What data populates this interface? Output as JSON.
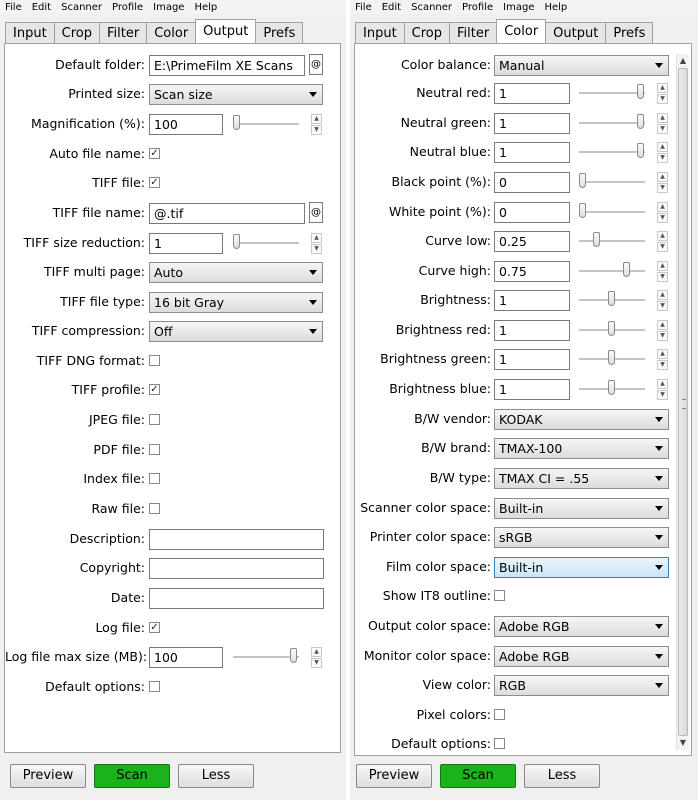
{
  "left": {
    "menu": [
      "File",
      "Edit",
      "Scanner",
      "Profile",
      "Image",
      "Help"
    ],
    "tabs": [
      "Input",
      "Crop",
      "Filter",
      "Color",
      "Output",
      "Prefs"
    ],
    "fields": {
      "default_folder": {
        "label": "Default folder:",
        "value": "E:\\PrimeFilm XE Scans",
        "at": "@"
      },
      "printed_size": {
        "label": "Printed size:",
        "value": "Scan size"
      },
      "magnification": {
        "label": "Magnification (%):",
        "value": "100"
      },
      "auto_file_name": {
        "label": "Auto file name:",
        "checked": true
      },
      "tiff_file": {
        "label": "TIFF file:",
        "checked": true
      },
      "tiff_file_name": {
        "label": "TIFF file name:",
        "value": "@.tif",
        "at": "@"
      },
      "tiff_size_reduction": {
        "label": "TIFF size reduction:",
        "value": "1"
      },
      "tiff_multi_page": {
        "label": "TIFF multi page:",
        "value": "Auto"
      },
      "tiff_file_type": {
        "label": "TIFF file type:",
        "value": "16 bit Gray"
      },
      "tiff_compression": {
        "label": "TIFF compression:",
        "value": "Off"
      },
      "tiff_dng_format": {
        "label": "TIFF DNG format:",
        "checked": false
      },
      "tiff_profile": {
        "label": "TIFF profile:",
        "checked": true
      },
      "jpeg_file": {
        "label": "JPEG file:",
        "checked": false
      },
      "pdf_file": {
        "label": "PDF file:",
        "checked": false
      },
      "index_file": {
        "label": "Index file:",
        "checked": false
      },
      "raw_file": {
        "label": "Raw file:",
        "checked": false
      },
      "description": {
        "label": "Description:",
        "value": ""
      },
      "copyright": {
        "label": "Copyright:",
        "value": ""
      },
      "date": {
        "label": "Date:",
        "value": ""
      },
      "log_file": {
        "label": "Log file:",
        "checked": true
      },
      "log_file_max_size": {
        "label": "Log file max size (MB):",
        "value": "100"
      },
      "default_options": {
        "label": "Default options:",
        "checked": false
      }
    },
    "buttons": {
      "preview": "Preview",
      "scan": "Scan",
      "less": "Less"
    }
  },
  "right": {
    "menu": [
      "File",
      "Edit",
      "Scanner",
      "Profile",
      "Image",
      "Help"
    ],
    "tabs": [
      "Input",
      "Crop",
      "Filter",
      "Color",
      "Output",
      "Prefs"
    ],
    "fields": {
      "color_balance": {
        "label": "Color balance:",
        "value": "Manual"
      },
      "neutral_red": {
        "label": "Neutral red:",
        "value": "1"
      },
      "neutral_green": {
        "label": "Neutral green:",
        "value": "1"
      },
      "neutral_blue": {
        "label": "Neutral blue:",
        "value": "1"
      },
      "black_point": {
        "label": "Black point (%):",
        "value": "0"
      },
      "white_point": {
        "label": "White point (%):",
        "value": "0"
      },
      "curve_low": {
        "label": "Curve low:",
        "value": "0.25"
      },
      "curve_high": {
        "label": "Curve high:",
        "value": "0.75"
      },
      "brightness": {
        "label": "Brightness:",
        "value": "1"
      },
      "brightness_red": {
        "label": "Brightness red:",
        "value": "1"
      },
      "brightness_green": {
        "label": "Brightness green:",
        "value": "1"
      },
      "brightness_blue": {
        "label": "Brightness blue:",
        "value": "1"
      },
      "bw_vendor": {
        "label": "B/W vendor:",
        "value": "KODAK"
      },
      "bw_brand": {
        "label": "B/W brand:",
        "value": "TMAX-100"
      },
      "bw_type": {
        "label": "B/W type:",
        "value": "TMAX CI = .55"
      },
      "scanner_color_space": {
        "label": "Scanner color space:",
        "value": "Built-in"
      },
      "printer_color_space": {
        "label": "Printer color space:",
        "value": "sRGB"
      },
      "film_color_space": {
        "label": "Film color space:",
        "value": "Built-in"
      },
      "show_it8_outline": {
        "label": "Show IT8 outline:",
        "checked": false
      },
      "output_color_space": {
        "label": "Output color space:",
        "value": "Adobe RGB"
      },
      "monitor_color_space": {
        "label": "Monitor color space:",
        "value": "Adobe RGB"
      },
      "view_color": {
        "label": "View color:",
        "value": "RGB"
      },
      "pixel_colors": {
        "label": "Pixel colors:",
        "checked": false
      },
      "default_options": {
        "label": "Default options:",
        "checked": false
      }
    },
    "buttons": {
      "preview": "Preview",
      "scan": "Scan",
      "less": "Less"
    }
  },
  "colors": {
    "scan_button": "#1bb31b",
    "content_bg": "#ffffff",
    "window_bg": "#f0f0f0"
  }
}
